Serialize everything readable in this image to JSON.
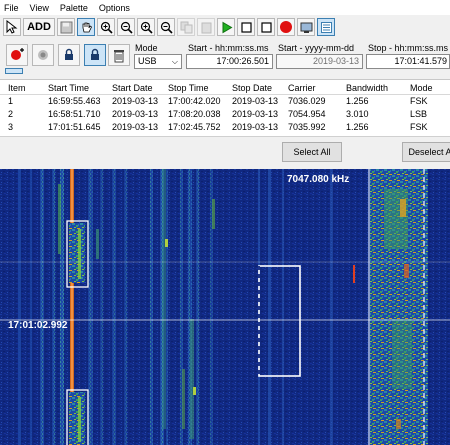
{
  "menu": [
    "File",
    "View",
    "Palette",
    "Options"
  ],
  "toolbar": {
    "add_label": "ADD"
  },
  "controls": {
    "mode_label": "Mode",
    "mode_value": "USB",
    "start_time_label": "Start - hh:mm:ss.ms",
    "start_time_value": "17:00:26.501",
    "start_date_label": "Start - yyyy-mm-dd",
    "start_date_value": "2019-03-13",
    "stop_time_label": "Stop - hh:mm:ss.ms",
    "stop_time_value": "17:01:41.579"
  },
  "table": {
    "headers": [
      "Item",
      "Start Time",
      "Start Date",
      "Stop Time",
      "Stop Date",
      "Carrier",
      "Bandwidth",
      "Mode"
    ],
    "rows": [
      [
        "1",
        "16:59:55.463",
        "2019-03-13",
        "17:00:42.020",
        "2019-03-13",
        "7036.029",
        "1.256",
        "FSK"
      ],
      [
        "2",
        "16:58:51.710",
        "2019-03-13",
        "17:08:20.038",
        "2019-03-13",
        "7054.954",
        "3.010",
        "LSB"
      ],
      [
        "3",
        "17:01:51.645",
        "2019-03-13",
        "17:02:45.752",
        "2019-03-13",
        "7035.992",
        "1.256",
        "FSK"
      ]
    ]
  },
  "buttons": {
    "select_all": "Select All",
    "deselect_all": "Deselect All"
  },
  "waterfall": {
    "frequency": "7047.080 kHz",
    "time_marker": "17:01:02.992"
  },
  "colors": {
    "waterfall_bg": "#102880",
    "selection_border": "#ffffff",
    "signal_hot": "#e07020"
  }
}
